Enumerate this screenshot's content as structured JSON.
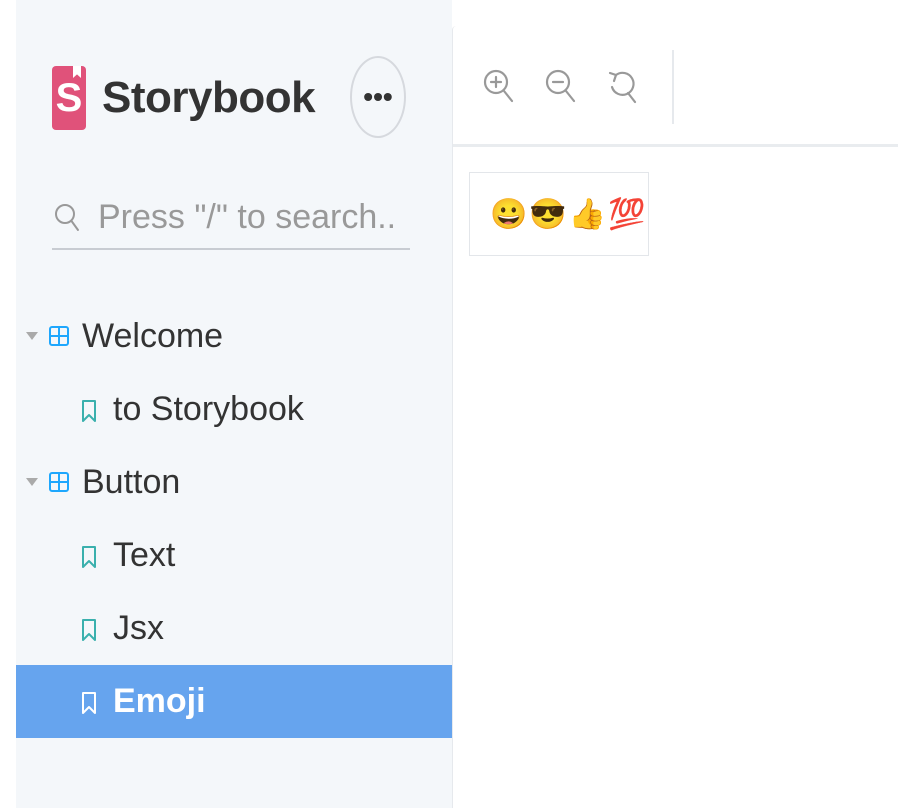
{
  "sidebar": {
    "brand": "Storybook",
    "brand_letter": "S",
    "menu_label": "•••",
    "search": {
      "placeholder": "Press \"/\" to search..."
    },
    "tree": [
      {
        "label": "Welcome",
        "type": "group"
      },
      {
        "label": "to Storybook",
        "type": "story"
      },
      {
        "label": "Button",
        "type": "group"
      },
      {
        "label": "Text",
        "type": "story"
      },
      {
        "label": "Jsx",
        "type": "story"
      },
      {
        "label": "Emoji",
        "type": "story",
        "selected": true
      }
    ]
  },
  "toolbar": {
    "tools": [
      "zoom-in-icon",
      "zoom-out-icon",
      "reset-zoom-icon"
    ]
  },
  "preview": {
    "emoji": [
      "😀",
      "😎",
      "👍",
      "💯"
    ]
  },
  "colors": {
    "brand": "#e0527a",
    "selected": "#66a4ee",
    "story_icon": "#3ab0ad",
    "group_icon": "#1ea7fd"
  }
}
